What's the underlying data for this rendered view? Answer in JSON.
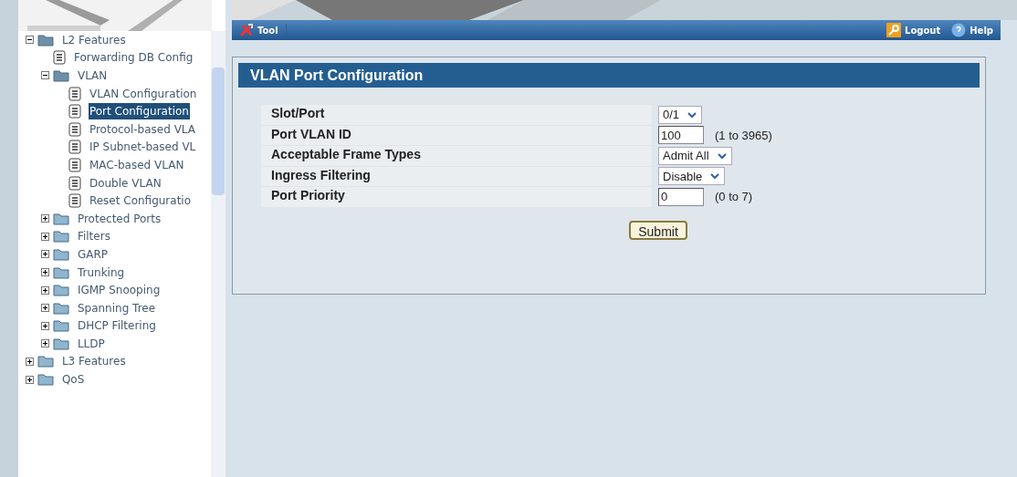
{
  "toolbar": {
    "tool": "Tool",
    "logout": "Logout",
    "help": "Help"
  },
  "tree": [
    {
      "label": "L2 Features",
      "kind": "folder",
      "expanded": true,
      "selected": false,
      "children": [
        {
          "label": "Forwarding DB Config",
          "kind": "page",
          "selected": false
        },
        {
          "label": "VLAN",
          "kind": "folder",
          "expanded": true,
          "selected": false,
          "children": [
            {
              "label": "VLAN Configuration",
              "kind": "page",
              "selected": false
            },
            {
              "label": "Port Configuration",
              "kind": "page",
              "selected": true
            },
            {
              "label": "Protocol-based VLA",
              "kind": "page",
              "selected": false
            },
            {
              "label": "IP Subnet-based VL",
              "kind": "page",
              "selected": false
            },
            {
              "label": "MAC-based VLAN",
              "kind": "page",
              "selected": false
            },
            {
              "label": "Double VLAN",
              "kind": "page",
              "selected": false
            },
            {
              "label": "Reset Configuratio",
              "kind": "page",
              "selected": false
            }
          ]
        },
        {
          "label": "Protected Ports",
          "kind": "folder",
          "expanded": false,
          "selected": false
        },
        {
          "label": "Filters",
          "kind": "folder",
          "expanded": false,
          "selected": false
        },
        {
          "label": "GARP",
          "kind": "folder",
          "expanded": false,
          "selected": false
        },
        {
          "label": "Trunking",
          "kind": "folder",
          "expanded": false,
          "selected": false
        },
        {
          "label": "IGMP Snooping",
          "kind": "folder",
          "expanded": false,
          "selected": false
        },
        {
          "label": "Spanning Tree",
          "kind": "folder",
          "expanded": false,
          "selected": false
        },
        {
          "label": "DHCP Filtering",
          "kind": "folder",
          "expanded": false,
          "selected": false
        },
        {
          "label": "LLDP",
          "kind": "folder",
          "expanded": false,
          "selected": false
        }
      ]
    },
    {
      "label": "L3 Features",
      "kind": "folder",
      "expanded": false,
      "selected": false
    },
    {
      "label": "QoS",
      "kind": "folder",
      "expanded": false,
      "selected": false
    }
  ],
  "panel": {
    "title": "VLAN Port Configuration",
    "rows": [
      {
        "label": "Slot/Port",
        "kind": "select",
        "value": "0/1"
      },
      {
        "label": "Port VLAN ID",
        "kind": "input",
        "value": "100",
        "hint": "(1 to 3965)"
      },
      {
        "label": "Acceptable Frame Types",
        "kind": "select",
        "value": "Admit All"
      },
      {
        "label": "Ingress Filtering",
        "kind": "select",
        "value": "Disable"
      },
      {
        "label": "Port Priority",
        "kind": "input",
        "value": "0",
        "hint": "(0 to 7)"
      }
    ],
    "submit": "Submit"
  }
}
